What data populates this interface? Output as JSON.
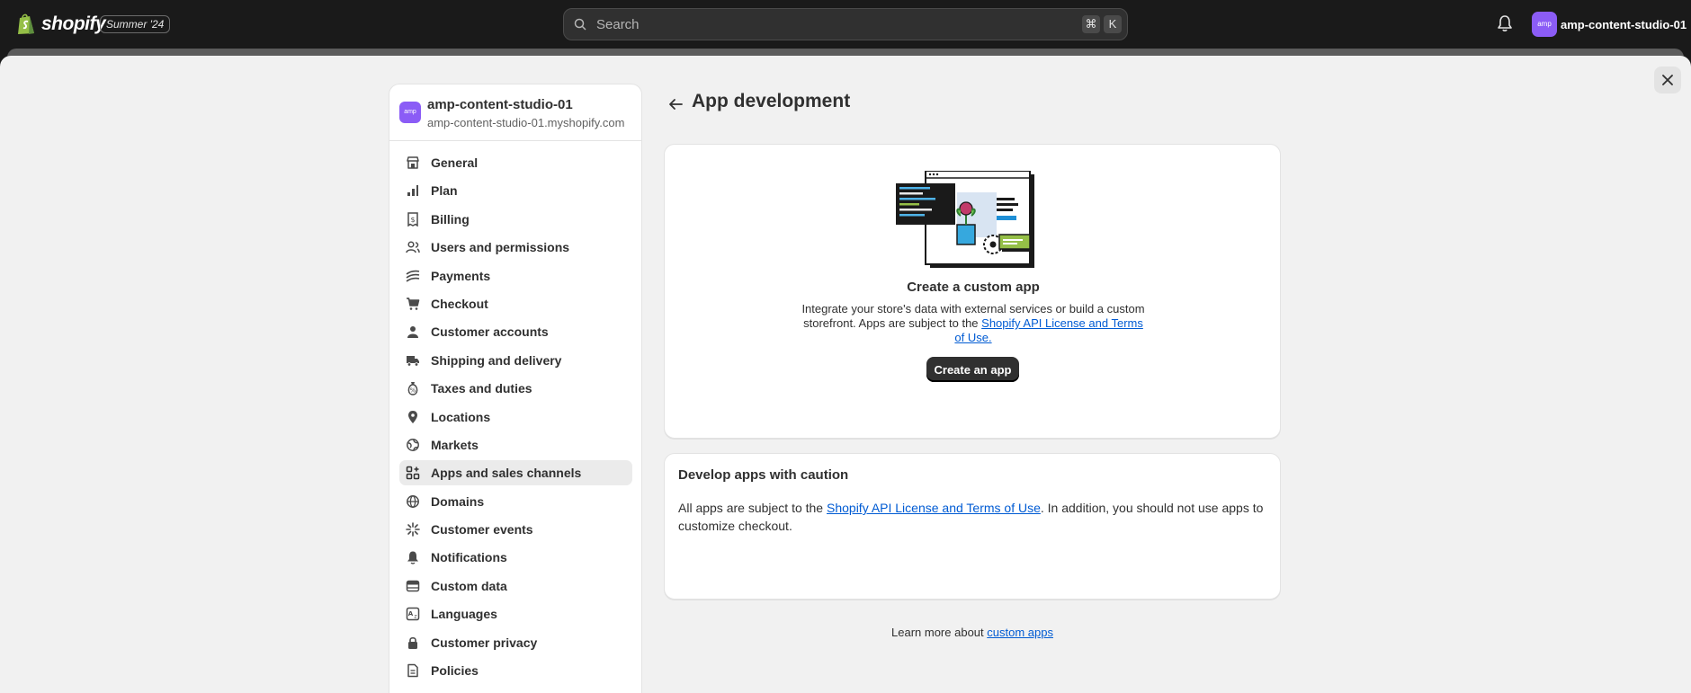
{
  "topbar": {
    "logo_text": "shopify",
    "edition_badge": "Summer '24",
    "search": {
      "placeholder": "Search",
      "shortcut_cmd": "⌘",
      "shortcut_key": "K"
    },
    "store_avatar": "amp",
    "store_name": "amp-content-studio-01"
  },
  "sidebar": {
    "store_avatar": "amp",
    "store_name": "amp-content-studio-01",
    "store_domain": "amp-content-studio-01.myshopify.com",
    "items": [
      {
        "label": "General"
      },
      {
        "label": "Plan"
      },
      {
        "label": "Billing"
      },
      {
        "label": "Users and permissions"
      },
      {
        "label": "Payments"
      },
      {
        "label": "Checkout"
      },
      {
        "label": "Customer accounts"
      },
      {
        "label": "Shipping and delivery"
      },
      {
        "label": "Taxes and duties"
      },
      {
        "label": "Locations"
      },
      {
        "label": "Markets"
      },
      {
        "label": "Apps and sales channels"
      },
      {
        "label": "Domains"
      },
      {
        "label": "Customer events"
      },
      {
        "label": "Notifications"
      },
      {
        "label": "Custom data"
      },
      {
        "label": "Languages"
      },
      {
        "label": "Customer privacy"
      },
      {
        "label": "Policies"
      }
    ],
    "active_item": "Apps and sales channels"
  },
  "main": {
    "title": "App development",
    "create_card": {
      "title": "Create a custom app",
      "text": "Integrate your store's data with external services or build a custom storefront. Apps are subject to the",
      "link": "Shopify API License and Terms of Use.",
      "button": "Create an app"
    },
    "caution_card": {
      "title": "Develop apps with caution",
      "text_before": "All apps are subject to the",
      "link": "Shopify API License and Terms of Use",
      "text_after": ". In addition, you should not use apps to customize checkout."
    },
    "learn_more": {
      "text": "Learn more about",
      "link": "custom apps"
    }
  },
  "colors": {
    "topbar": "#1a1a1a",
    "surface": "#f1f1f1",
    "link": "#005bd3",
    "accent_avatar": "#8b5cf6",
    "primary_button": "#303030"
  }
}
